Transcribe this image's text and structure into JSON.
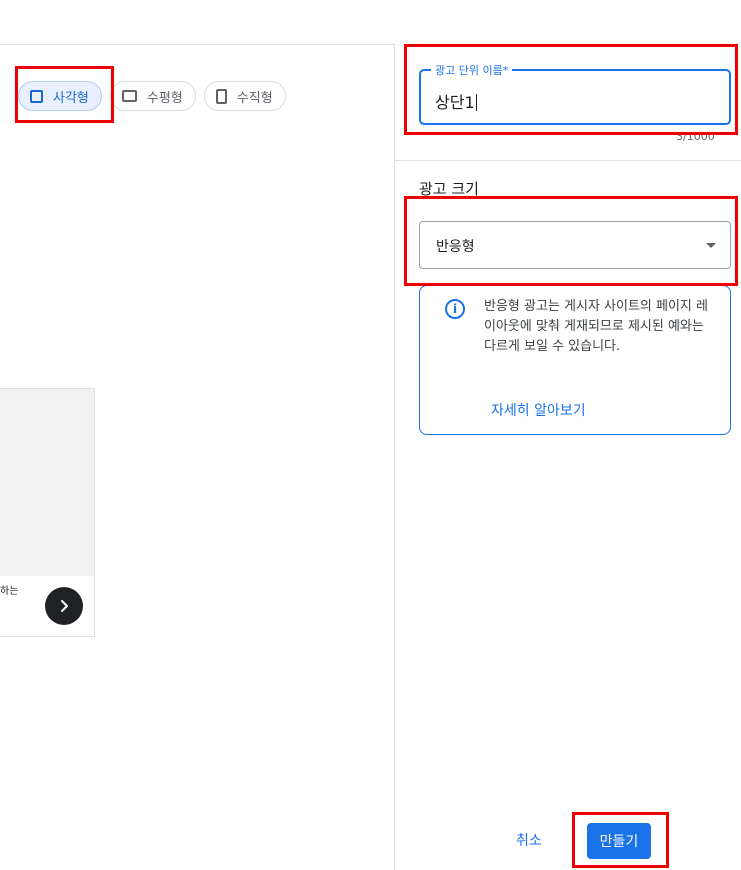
{
  "shape_chips": [
    {
      "label": "사각형",
      "icon": "square-icon",
      "selected": true
    },
    {
      "label": "수평형",
      "icon": "horizontal-rect-icon",
      "selected": false
    },
    {
      "label": "수직형",
      "icon": "vertical-rect-icon",
      "selected": false
    }
  ],
  "preview": {
    "text": "하는",
    "next_icon": "chevron-right-icon"
  },
  "ad_unit_name": {
    "label": "광고 단위 이름*",
    "value": "상단1",
    "char_count": "3/1000"
  },
  "ad_size": {
    "label": "광고 크기",
    "selected": "반응형"
  },
  "info": {
    "icon": "info-icon",
    "text": "반응형 광고는 게시자 사이트의 페이지 레이아웃에 맞춰 게재되므로 제시된 예와는 다르게 보일 수 있습니다.",
    "link": "자세히 알아보기"
  },
  "actions": {
    "cancel": "취소",
    "create": "만들기"
  },
  "colors": {
    "accent": "#1a73e8",
    "annotation": "#ee0000",
    "chip_selected_bg": "#e8f0fe"
  }
}
